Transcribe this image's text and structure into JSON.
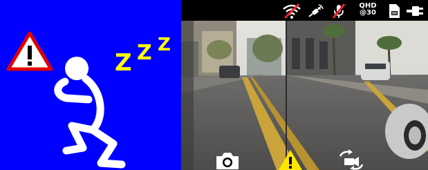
{
  "alert": {
    "sleep_letters": [
      "Z",
      "Z",
      "Z"
    ],
    "background": "#0000ff",
    "accent": "#ffff00",
    "warning_red": "#e00000"
  },
  "status_bar": {
    "resolution_line1": "QHD",
    "resolution_line2": "@30",
    "icons": [
      "wifi-off-icon",
      "gps-satellite-icon",
      "mic-muted-icon",
      "sd-card-icon",
      "power-plug-icon"
    ]
  },
  "controls": {
    "icons": [
      "camera-snapshot-icon",
      "emergency-lock-icon",
      "switch-camera-icon"
    ]
  }
}
